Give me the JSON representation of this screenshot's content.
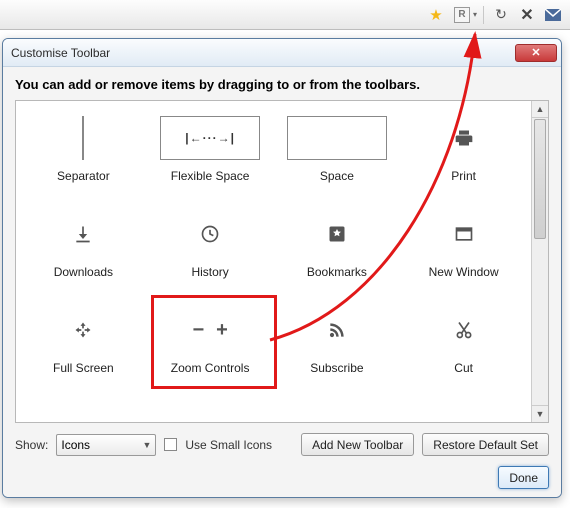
{
  "dialog": {
    "title": "Customise Toolbar",
    "instruction": "You can add or remove items by dragging to or from the toolbars.",
    "items": [
      {
        "label": "Separator",
        "icon": "separator"
      },
      {
        "label": "Flexible Space",
        "icon": "flexspace"
      },
      {
        "label": "Space",
        "icon": "space"
      },
      {
        "label": "Print",
        "icon": "print"
      },
      {
        "label": "Downloads",
        "icon": "download"
      },
      {
        "label": "History",
        "icon": "history"
      },
      {
        "label": "Bookmarks",
        "icon": "bookmark"
      },
      {
        "label": "New Window",
        "icon": "newwindow"
      },
      {
        "label": "Full Screen",
        "icon": "fullscreen"
      },
      {
        "label": "Zoom Controls",
        "icon": "zoom"
      },
      {
        "label": "Subscribe",
        "icon": "rss"
      },
      {
        "label": "Cut",
        "icon": "cut"
      }
    ],
    "show_label": "Show:",
    "show_value": "Icons",
    "small_icons_label": "Use Small Icons",
    "add_toolbar_label": "Add New Toolbar",
    "restore_label": "Restore Default Set",
    "done_label": "Done"
  }
}
